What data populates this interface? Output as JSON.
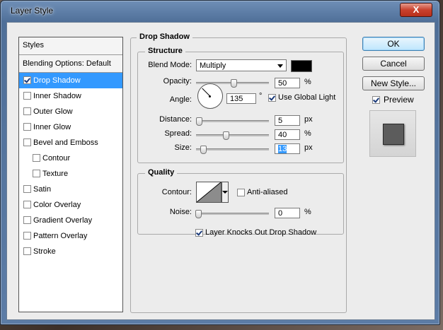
{
  "window": {
    "title": "Layer Style",
    "close_label": "X"
  },
  "styles_panel": {
    "header": "Styles",
    "blending_options": "Blending Options: Default",
    "items": [
      {
        "label": "Drop Shadow",
        "checked": true,
        "selected": true,
        "sub": false
      },
      {
        "label": "Inner Shadow",
        "checked": false,
        "selected": false,
        "sub": false
      },
      {
        "label": "Outer Glow",
        "checked": false,
        "selected": false,
        "sub": false
      },
      {
        "label": "Inner Glow",
        "checked": false,
        "selected": false,
        "sub": false
      },
      {
        "label": "Bevel and Emboss",
        "checked": false,
        "selected": false,
        "sub": false
      },
      {
        "label": "Contour",
        "checked": false,
        "selected": false,
        "sub": true
      },
      {
        "label": "Texture",
        "checked": false,
        "selected": false,
        "sub": true
      },
      {
        "label": "Satin",
        "checked": false,
        "selected": false,
        "sub": false
      },
      {
        "label": "Color Overlay",
        "checked": false,
        "selected": false,
        "sub": false
      },
      {
        "label": "Gradient Overlay",
        "checked": false,
        "selected": false,
        "sub": false
      },
      {
        "label": "Pattern Overlay",
        "checked": false,
        "selected": false,
        "sub": false
      },
      {
        "label": "Stroke",
        "checked": false,
        "selected": false,
        "sub": false
      }
    ]
  },
  "drop_shadow": {
    "title": "Drop Shadow",
    "structure": {
      "title": "Structure",
      "blend_mode_label": "Blend Mode:",
      "blend_mode_value": "Multiply",
      "shadow_color": "#000000",
      "opacity_label": "Opacity:",
      "opacity_value": "50",
      "opacity_unit": "%",
      "angle_label": "Angle:",
      "angle_value": "135",
      "angle_unit": "°",
      "use_global_light_label": "Use Global Light",
      "use_global_light": true,
      "distance_label": "Distance:",
      "distance_value": "5",
      "distance_unit": "px",
      "spread_label": "Spread:",
      "spread_value": "40",
      "spread_unit": "%",
      "size_label": "Size:",
      "size_value": "13",
      "size_unit": "px"
    },
    "quality": {
      "title": "Quality",
      "contour_label": "Contour:",
      "anti_aliased_label": "Anti-aliased",
      "anti_aliased": false,
      "noise_label": "Noise:",
      "noise_value": "0",
      "noise_unit": "%"
    },
    "knockout_label": "Layer Knocks Out Drop Shadow",
    "knockout": true
  },
  "buttons": {
    "ok": "OK",
    "cancel": "Cancel",
    "new_style": "New Style...",
    "preview_label": "Preview",
    "preview_checked": true
  }
}
